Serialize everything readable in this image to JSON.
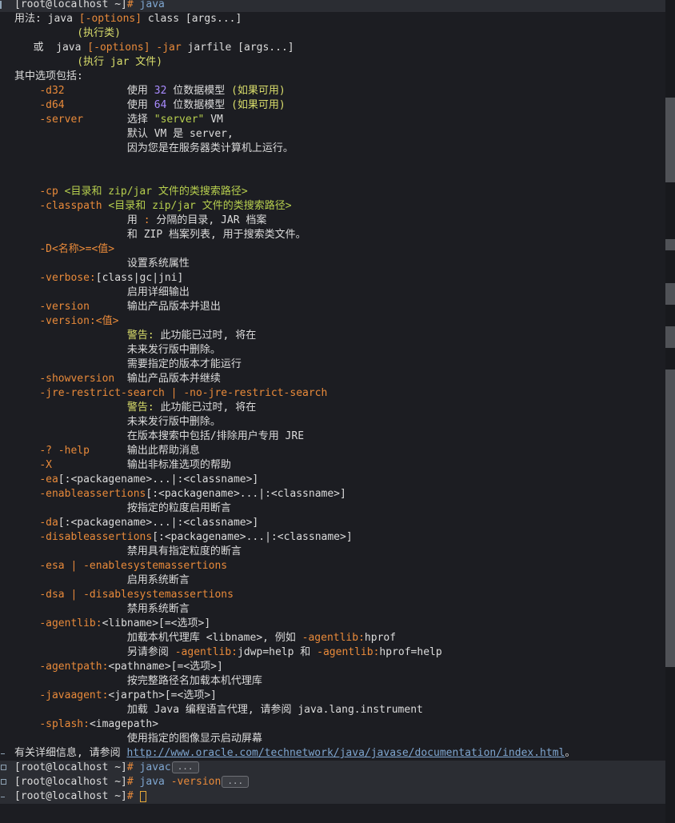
{
  "terminal": {
    "prompt": "[root@localhost ~]",
    "prompt_symbol": "#",
    "command": "java",
    "usage_label": "用法:",
    "usage_java": "java",
    "usage_options": "[-options]",
    "usage_rest": "class [args...]",
    "usage_note1": "(执行类)",
    "usage_or": "或",
    "usage_jar_flag": "-jar",
    "usage_jar_rest": "jarfile [args...]",
    "usage_note2": "(执行 jar 文件)",
    "options_header": "其中选项包括:",
    "opt_d32": "-d32",
    "d32_use": "使用",
    "d32_num": "32",
    "d32_desc": "位数据模型",
    "d32_avail": "(如果可用)",
    "opt_d64": "-d64",
    "d64_use": "使用",
    "d64_num": "64",
    "d64_desc": "位数据模型",
    "d64_avail": "(如果可用)",
    "opt_server": "-server",
    "server_select": "选择",
    "server_quote": "\"server\"",
    "server_vm": "VM",
    "server_default": "默认 VM 是 server,",
    "server_reason": "因为您是在服务器类计算机上运行。",
    "opt_cp": "-cp",
    "cp_desc": "<目录和 zip/jar 文件的类搜索路径>",
    "opt_classpath": "-classpath",
    "classpath_desc": "<目录和 zip/jar 文件的类搜索路径>",
    "classpath_sep_pre": "用",
    "classpath_sep_colon": ":",
    "classpath_sep_post": "分隔的目录, JAR 档案",
    "classpath_zip": "和 ZIP 档案列表, 用于搜索类文件。",
    "opt_D": "-D<名称>=<值>",
    "D_desc": "设置系统属性",
    "opt_verbose": "-verbose:",
    "verbose_args": "[class|gc|jni]",
    "verbose_desc": "启用详细输出",
    "opt_version": "-version",
    "version_desc": "输出产品版本并退出",
    "opt_version_val": "-version:<值>",
    "warn_label": "警告:",
    "warn_text": "此功能已过时, 将在",
    "future_removed": "未来发行版中删除。",
    "need_version": "需要指定的版本才能运行",
    "opt_showversion": "-showversion",
    "showversion_desc": "输出产品版本并继续",
    "opt_jre": "-jre-restrict-search | -no-jre-restrict-search",
    "jre_warn_label": "警告:",
    "jre_warn_text": "此功能已过时, 将在",
    "jre_future_removed": "未来发行版中删除。",
    "jre_desc": "在版本搜索中包括/排除用户专用 JRE",
    "opt_help": "-? -help",
    "help_desc": "输出此帮助消息",
    "opt_X": "-X",
    "X_desc": "输出非标准选项的帮助",
    "opt_ea": "-ea",
    "ea_args": "[:<packagename>...|:<classname>]",
    "opt_enableassertions": "-enableassertions",
    "enableassertions_args": "[:<packagename>...|:<classname>]",
    "enableassertions_desc": "按指定的粒度启用断言",
    "opt_da": "-da",
    "da_args": "[:<packagename>...|:<classname>]",
    "opt_disableassertions": "-disableassertions",
    "disableassertions_args": "[:<packagename>...|:<classname>]",
    "disableassertions_desc": "禁用具有指定粒度的断言",
    "opt_esa": "-esa | -enablesystemassertions",
    "esa_desc": "启用系统断言",
    "opt_dsa": "-dsa | -disablesystemassertions",
    "dsa_desc": "禁用系统断言",
    "opt_agentlib": "-agentlib:",
    "agentlib_args": "<libname>[=<选项>]",
    "agentlib_desc_pre": "加载本机代理库 <libname>, 例如",
    "agentlib_ex_flag": "-agentlib:",
    "agentlib_ex_val": "hprof",
    "agentlib_see_pre": "另请参阅",
    "agentlib_see_flag1": "-agentlib:",
    "agentlib_see_val1": "jdwp=help",
    "agentlib_see_and": "和",
    "agentlib_see_flag2": "-agentlib:",
    "agentlib_see_val2": "hprof=help",
    "opt_agentpath": "-agentpath:",
    "agentpath_args": "<pathname>[=<选项>]",
    "agentpath_desc": "按完整路径名加载本机代理库",
    "opt_javaagent": "-javaagent:",
    "javaagent_args": "<jarpath>[=<选项>]",
    "javaagent_desc": "加载 Java 编程语言代理, 请参阅 java.lang.instrument",
    "opt_splash": "-splash:",
    "splash_args": "<imagepath>",
    "splash_desc": "使用指定的图像显示启动屏幕",
    "more_info": "有关详细信息, 请参阅",
    "more_url": "http://www.oracle.com/technetwork/java/javase/documentation/index.html",
    "more_end": "。",
    "cmd2": "javac",
    "cmd3_java": "java",
    "cmd3_flag": "-version",
    "fold_label": "..."
  }
}
